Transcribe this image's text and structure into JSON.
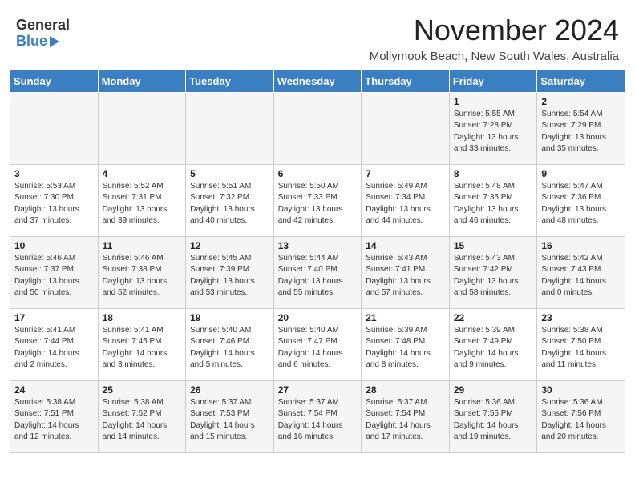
{
  "header": {
    "logo_general": "General",
    "logo_blue": "Blue",
    "month_title": "November 2024",
    "location": "Mollymook Beach, New South Wales, Australia"
  },
  "weekdays": [
    "Sunday",
    "Monday",
    "Tuesday",
    "Wednesday",
    "Thursday",
    "Friday",
    "Saturday"
  ],
  "weeks": [
    [
      {
        "day": "",
        "info": ""
      },
      {
        "day": "",
        "info": ""
      },
      {
        "day": "",
        "info": ""
      },
      {
        "day": "",
        "info": ""
      },
      {
        "day": "",
        "info": ""
      },
      {
        "day": "1",
        "info": "Sunrise: 5:55 AM\nSunset: 7:28 PM\nDaylight: 13 hours\nand 33 minutes."
      },
      {
        "day": "2",
        "info": "Sunrise: 5:54 AM\nSunset: 7:29 PM\nDaylight: 13 hours\nand 35 minutes."
      }
    ],
    [
      {
        "day": "3",
        "info": "Sunrise: 5:53 AM\nSunset: 7:30 PM\nDaylight: 13 hours\nand 37 minutes."
      },
      {
        "day": "4",
        "info": "Sunrise: 5:52 AM\nSunset: 7:31 PM\nDaylight: 13 hours\nand 39 minutes."
      },
      {
        "day": "5",
        "info": "Sunrise: 5:51 AM\nSunset: 7:32 PM\nDaylight: 13 hours\nand 40 minutes."
      },
      {
        "day": "6",
        "info": "Sunrise: 5:50 AM\nSunset: 7:33 PM\nDaylight: 13 hours\nand 42 minutes."
      },
      {
        "day": "7",
        "info": "Sunrise: 5:49 AM\nSunset: 7:34 PM\nDaylight: 13 hours\nand 44 minutes."
      },
      {
        "day": "8",
        "info": "Sunrise: 5:48 AM\nSunset: 7:35 PM\nDaylight: 13 hours\nand 46 minutes."
      },
      {
        "day": "9",
        "info": "Sunrise: 5:47 AM\nSunset: 7:36 PM\nDaylight: 13 hours\nand 48 minutes."
      }
    ],
    [
      {
        "day": "10",
        "info": "Sunrise: 5:46 AM\nSunset: 7:37 PM\nDaylight: 13 hours\nand 50 minutes."
      },
      {
        "day": "11",
        "info": "Sunrise: 5:46 AM\nSunset: 7:38 PM\nDaylight: 13 hours\nand 52 minutes."
      },
      {
        "day": "12",
        "info": "Sunrise: 5:45 AM\nSunset: 7:39 PM\nDaylight: 13 hours\nand 53 minutes."
      },
      {
        "day": "13",
        "info": "Sunrise: 5:44 AM\nSunset: 7:40 PM\nDaylight: 13 hours\nand 55 minutes."
      },
      {
        "day": "14",
        "info": "Sunrise: 5:43 AM\nSunset: 7:41 PM\nDaylight: 13 hours\nand 57 minutes."
      },
      {
        "day": "15",
        "info": "Sunrise: 5:43 AM\nSunset: 7:42 PM\nDaylight: 13 hours\nand 58 minutes."
      },
      {
        "day": "16",
        "info": "Sunrise: 5:42 AM\nSunset: 7:43 PM\nDaylight: 14 hours\nand 0 minutes."
      }
    ],
    [
      {
        "day": "17",
        "info": "Sunrise: 5:41 AM\nSunset: 7:44 PM\nDaylight: 14 hours\nand 2 minutes."
      },
      {
        "day": "18",
        "info": "Sunrise: 5:41 AM\nSunset: 7:45 PM\nDaylight: 14 hours\nand 3 minutes."
      },
      {
        "day": "19",
        "info": "Sunrise: 5:40 AM\nSunset: 7:46 PM\nDaylight: 14 hours\nand 5 minutes."
      },
      {
        "day": "20",
        "info": "Sunrise: 5:40 AM\nSunset: 7:47 PM\nDaylight: 14 hours\nand 6 minutes."
      },
      {
        "day": "21",
        "info": "Sunrise: 5:39 AM\nSunset: 7:48 PM\nDaylight: 14 hours\nand 8 minutes."
      },
      {
        "day": "22",
        "info": "Sunrise: 5:39 AM\nSunset: 7:49 PM\nDaylight: 14 hours\nand 9 minutes."
      },
      {
        "day": "23",
        "info": "Sunrise: 5:38 AM\nSunset: 7:50 PM\nDaylight: 14 hours\nand 11 minutes."
      }
    ],
    [
      {
        "day": "24",
        "info": "Sunrise: 5:38 AM\nSunset: 7:51 PM\nDaylight: 14 hours\nand 12 minutes."
      },
      {
        "day": "25",
        "info": "Sunrise: 5:38 AM\nSunset: 7:52 PM\nDaylight: 14 hours\nand 14 minutes."
      },
      {
        "day": "26",
        "info": "Sunrise: 5:37 AM\nSunset: 7:53 PM\nDaylight: 14 hours\nand 15 minutes."
      },
      {
        "day": "27",
        "info": "Sunrise: 5:37 AM\nSunset: 7:54 PM\nDaylight: 14 hours\nand 16 minutes."
      },
      {
        "day": "28",
        "info": "Sunrise: 5:37 AM\nSunset: 7:54 PM\nDaylight: 14 hours\nand 17 minutes."
      },
      {
        "day": "29",
        "info": "Sunrise: 5:36 AM\nSunset: 7:55 PM\nDaylight: 14 hours\nand 19 minutes."
      },
      {
        "day": "30",
        "info": "Sunrise: 5:36 AM\nSunset: 7:56 PM\nDaylight: 14 hours\nand 20 minutes."
      }
    ]
  ]
}
